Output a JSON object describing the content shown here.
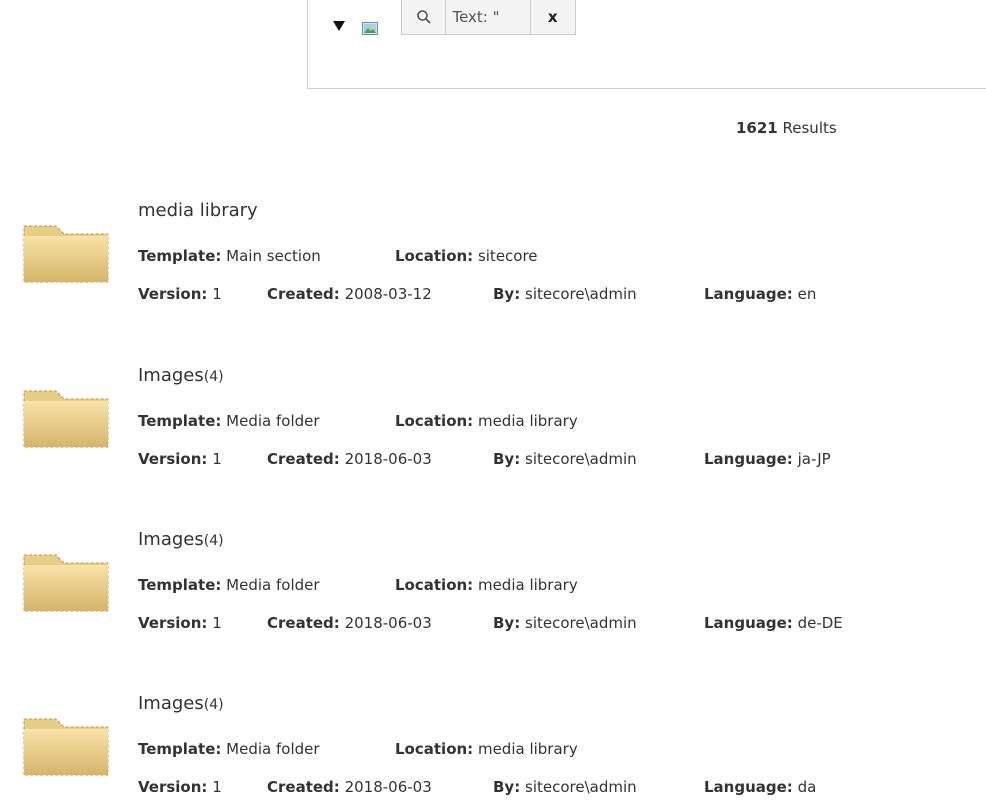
{
  "search": {
    "text_segment": "Text: \"",
    "close_label": "x"
  },
  "results_summary": {
    "count": "1621",
    "label": " Results"
  },
  "labels": {
    "template": "Template:",
    "location": "Location:",
    "version": "Version:",
    "created": "Created:",
    "by": "By:",
    "language": "Language:"
  },
  "results": [
    {
      "title": "media library",
      "count": "",
      "template": "Main section",
      "location": "sitecore",
      "version": "1",
      "created": "2008-03-12",
      "by": "sitecore\\admin",
      "language": "en"
    },
    {
      "title": "Images",
      "count": "(4)",
      "template": "Media folder",
      "location": "media library",
      "version": "1",
      "created": "2018-06-03",
      "by": "sitecore\\admin",
      "language": "ja-JP"
    },
    {
      "title": "Images",
      "count": "(4)",
      "template": "Media folder",
      "location": "media library",
      "version": "1",
      "created": "2018-06-03",
      "by": "sitecore\\admin",
      "language": "de-DE"
    },
    {
      "title": "Images",
      "count": "(4)",
      "template": "Media folder",
      "location": "media library",
      "version": "1",
      "created": "2018-06-03",
      "by": "sitecore\\admin",
      "language": "da"
    }
  ]
}
